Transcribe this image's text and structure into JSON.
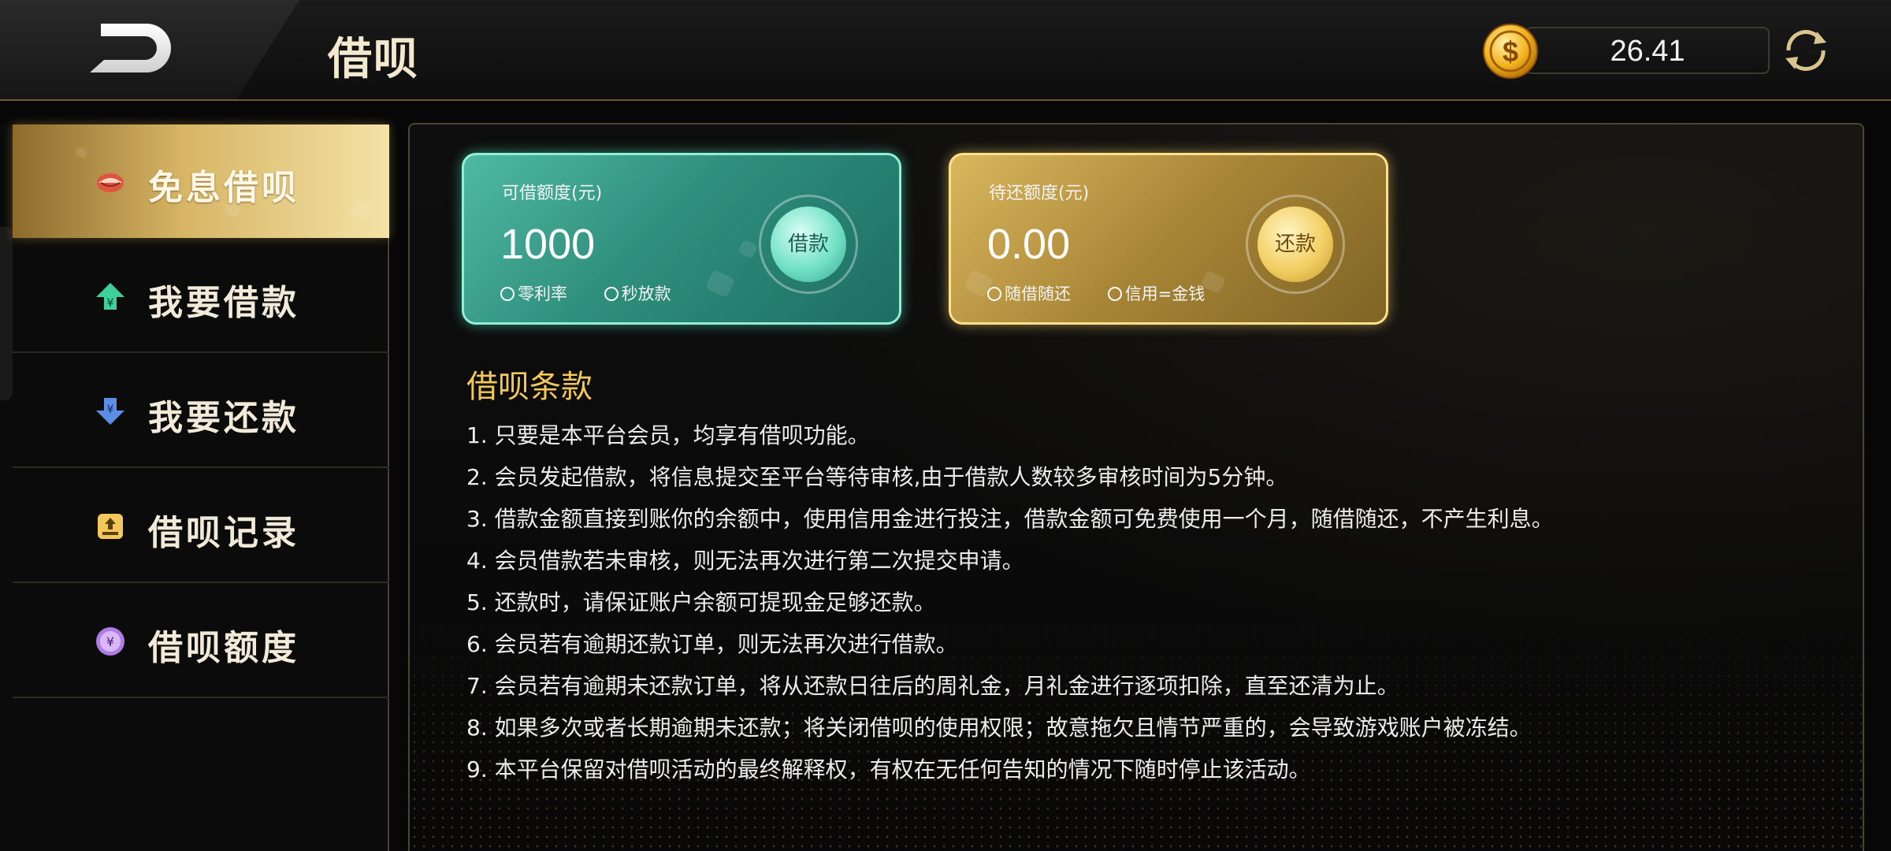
{
  "header": {
    "title": "借呗",
    "balance": "26.41",
    "icons": {
      "back": "back-arrow-icon",
      "coin": "gold-coin-icon",
      "refresh": "refresh-icon"
    }
  },
  "sidebar": {
    "items": [
      {
        "label": "免息借呗",
        "icon": "lips-icon",
        "active": true
      },
      {
        "label": "我要借款",
        "icon": "borrow-up-icon",
        "active": false
      },
      {
        "label": "我要还款",
        "icon": "repay-down-icon",
        "active": false
      },
      {
        "label": "借呗记录",
        "icon": "record-icon",
        "active": false
      },
      {
        "label": "借呗额度",
        "icon": "quota-coin-icon",
        "active": false
      }
    ]
  },
  "cards": {
    "borrow": {
      "title": "可借额度(元)",
      "amount": "1000",
      "button": "借款",
      "tags": [
        "零利率",
        "秒放款"
      ],
      "color": "#2f8f7d"
    },
    "repay": {
      "title": "待还额度(元)",
      "amount": "0.00",
      "button": "还款",
      "tags": [
        "随借随还",
        "信用=金钱"
      ],
      "color": "#a78536"
    }
  },
  "terms": {
    "title": "借呗条款",
    "items": [
      "1. 只要是本平台会员，均享有借呗功能。",
      "2. 会员发起借款，将信息提交至平台等待审核,由于借款人数较多审核时间为5分钟。",
      "3. 借款金额直接到账你的余额中，使用信用金进行投注，借款金额可免费使用一个月，随借随还，不产生利息。",
      "4. 会员借款若未审核，则无法再次进行第二次提交申请。",
      "5. 还款时，请保证账户余额可提现金足够还款。",
      "6. 会员若有逾期还款订单，则无法再次进行借款。",
      "7. 会员若有逾期未还款订单，将从还款日往后的周礼金，月礼金进行逐项扣除，直至还清为止。",
      "8. 如果多次或者长期逾期未还款；将关闭借呗的使用权限；故意拖欠且情节严重的，会导致游戏账户被冻结。",
      "9. 本平台保留对借呗活动的最终解释权，有权在无任何告知的情况下随时停止该活动。"
    ]
  },
  "colors": {
    "accent_gold": "#f3c85a",
    "border_gold": "#6b5a35",
    "active_tab": "#d7b565"
  }
}
